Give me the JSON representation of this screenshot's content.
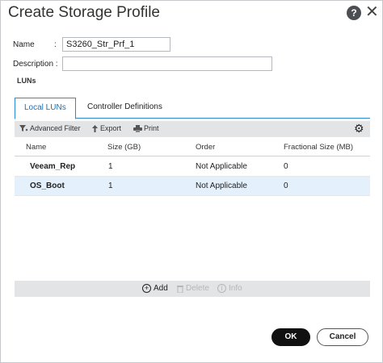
{
  "dialog": {
    "title": "Create Storage Profile",
    "help_glyph": "?",
    "close_glyph": "✕"
  },
  "form": {
    "name_label": "Name",
    "name_colon": ":",
    "name_value": "S3260_Str_Prf_1",
    "description_label": "Description :",
    "description_value": ""
  },
  "section_label": "LUNs",
  "tabs": [
    {
      "label": "Local LUNs",
      "active": true
    },
    {
      "label": "Controller Definitions",
      "active": false
    }
  ],
  "toolbar": {
    "advanced_filter": "Advanced Filter",
    "export": "Export",
    "print": "Print"
  },
  "table": {
    "columns": [
      "Name",
      "Size (GB)",
      "Order",
      "Fractional Size (MB)"
    ],
    "rows": [
      [
        "Veeam_Rep",
        "1",
        "Not Applicable",
        "0"
      ],
      [
        "OS_Boot",
        "1",
        "Not Applicable",
        "0"
      ]
    ]
  },
  "footer_actions": {
    "add": "Add",
    "delete": "Delete",
    "info": "Info"
  },
  "buttons": {
    "ok": "OK",
    "cancel": "Cancel"
  },
  "colors": {
    "accent": "#2b8ad6",
    "selected_row": "#e4f0fb",
    "primary_button": "#111111"
  }
}
